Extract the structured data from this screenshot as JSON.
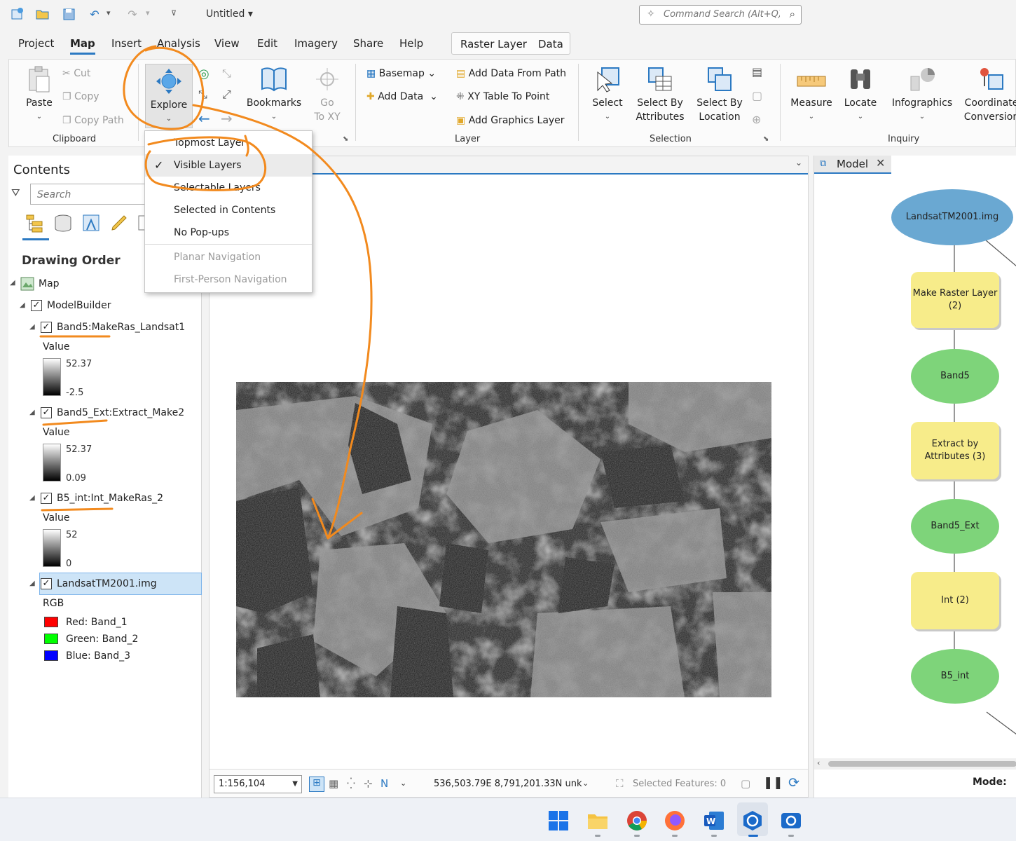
{
  "app": {
    "doc_title": "Untitled",
    "command_search_placeholder": "Command Search (Alt+Q)"
  },
  "menu": {
    "tabs": [
      "Project",
      "Map",
      "Insert",
      "Analysis",
      "View",
      "Edit",
      "Imagery",
      "Share",
      "Help"
    ],
    "active": "Map",
    "context_tabs": [
      "Raster Layer",
      "Data"
    ]
  },
  "ribbon": {
    "clipboard": {
      "paste": "Paste",
      "cut": "Cut",
      "copy": "Copy",
      "copy_path": "Copy Path",
      "group": "Clipboard"
    },
    "navigate": {
      "explore": "Explore",
      "bookmarks": "Bookmarks",
      "go_to_xy_line1": "Go",
      "go_to_xy_line2": "To XY"
    },
    "layer": {
      "basemap": "Basemap",
      "add_data": "Add Data",
      "add_data_from_path": "Add Data From Path",
      "xy_table_to_point": "XY Table To Point",
      "add_graphics_layer": "Add Graphics Layer",
      "group": "Layer"
    },
    "selection": {
      "select": "Select",
      "select_by_attributes_line1": "Select By",
      "select_by_attributes_line2": "Attributes",
      "select_by_location_line1": "Select By",
      "select_by_location_line2": "Location",
      "group": "Selection"
    },
    "inquiry": {
      "measure": "Measure",
      "locate": "Locate",
      "infographics": "Infographics",
      "coordinate_conversion_line1": "Coordinate",
      "coordinate_conversion_line2": "Conversion",
      "group": "Inquiry"
    }
  },
  "explore_menu": {
    "items": [
      {
        "label": "Topmost Layer",
        "checked": false,
        "disabled": false
      },
      {
        "label": "Visible Layers",
        "checked": true,
        "disabled": false
      },
      {
        "label": "Selectable Layers",
        "checked": false,
        "disabled": false
      },
      {
        "label": "Selected in Contents",
        "checked": false,
        "disabled": false
      },
      {
        "label": "No Pop-ups",
        "checked": false,
        "disabled": false
      },
      {
        "label": "Planar Navigation",
        "checked": false,
        "disabled": true
      },
      {
        "label": "First-Person Navigation",
        "checked": false,
        "disabled": true
      }
    ],
    "check_glyph": "✓"
  },
  "contents": {
    "title": "Contents",
    "search_placeholder": "Search",
    "section": "Drawing Order",
    "map_label": "Map",
    "group_label": "ModelBuilder",
    "check_glyph": "✓",
    "value_label": "Value",
    "layers": [
      {
        "name": "Band5:MakeRas_Landsat1",
        "max": "52.37",
        "min": "-2.5"
      },
      {
        "name": "Band5_Ext:Extract_Make2",
        "max": "52.37",
        "min": "0.09"
      },
      {
        "name": "B5_int:Int_MakeRas_2",
        "max": "52",
        "min": "0"
      }
    ],
    "rgb_layer": {
      "name": "LandsatTM2001.img",
      "type_label": "RGB",
      "bands": [
        {
          "label": "Red:   Band_1",
          "color": "#ff0000"
        },
        {
          "label": "Green: Band_2",
          "color": "#00ff00"
        },
        {
          "label": "Blue:  Band_3",
          "color": "#0000ff"
        }
      ]
    }
  },
  "mapview": {
    "scale": "1:156,104",
    "coordinates": "536,503.79E 8,791,201.33N unk",
    "selected_features": "Selected Features: 0"
  },
  "model": {
    "tab_label": "Model",
    "mode_label": "Mode:",
    "nodes": [
      {
        "label": "LandsatTM2001.img",
        "kind": "data-input"
      },
      {
        "label": "Make Raster Layer (2)",
        "kind": "tool"
      },
      {
        "label": "Band5",
        "kind": "data-output"
      },
      {
        "label": "Extract by Attributes (3)",
        "kind": "tool"
      },
      {
        "label": "Band5_Ext",
        "kind": "data-output"
      },
      {
        "label": "Int (2)",
        "kind": "tool"
      },
      {
        "label": "B5_int",
        "kind": "data-output"
      }
    ]
  },
  "colors": {
    "accent": "#2b79c2",
    "annotation": "#f28a1e",
    "model_input": "#6aa8d2",
    "model_output": "#7ed47a",
    "model_tool": "#f7ec8a"
  }
}
